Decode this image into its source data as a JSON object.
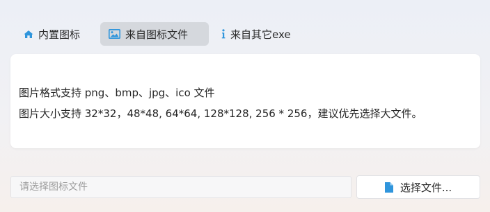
{
  "tabs": [
    {
      "label": "内置图标",
      "icon": "home-icon"
    },
    {
      "label": "来自图标文件",
      "icon": "image-icon",
      "selected": true
    },
    {
      "label": "来自其它exe",
      "icon": "info-icon"
    }
  ],
  "info": {
    "line1": "图片格式支持 png、bmp、jpg、ico 文件",
    "line2": "图片大小支持 32*32，48*48, 64*64, 128*128, 256 * 256，建议优先选择大文件。"
  },
  "file_input": {
    "value": "",
    "placeholder": "请选择图标文件"
  },
  "choose_button": {
    "label": "选择文件...",
    "icon": "file-icon"
  },
  "colors": {
    "accent": "#2f95dc",
    "selected_tab": "#d5d8dd"
  }
}
